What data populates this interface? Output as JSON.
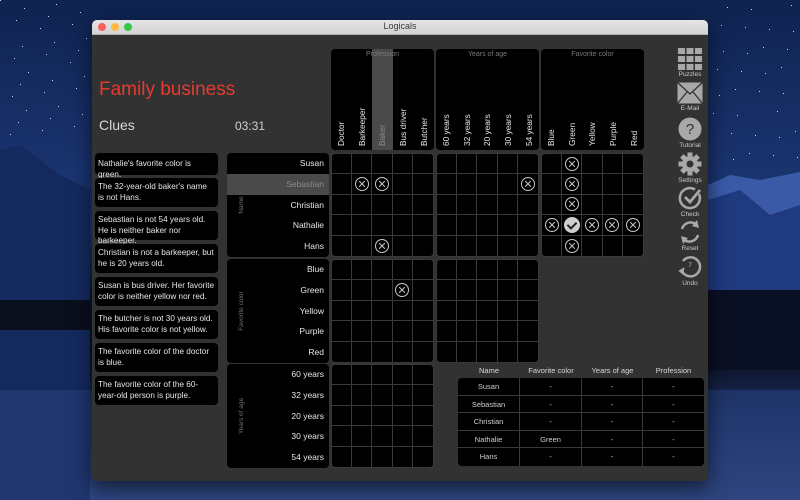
{
  "window": {
    "title": "Logicals"
  },
  "puzzle": {
    "title": "Family business",
    "clues_label": "Clues",
    "timer": "03:31"
  },
  "clues": [
    "Nathalie's favorite color is green.",
    "The 32-year-old baker's name is not Hans.",
    "Sebastian is not 54 years old. He is neither baker nor barkeeper.",
    "Christian is not a barkeeper, but he is 20 years old.",
    "Susan is bus driver. Her favorite color is neither yellow nor red.",
    "The butcher is not 30 years old. His favorite color is not yellow.",
    "The favorite color of the doctor is blue.",
    "The favorite color of the 60-year-old person is purple."
  ],
  "columns": [
    {
      "title": "Profession",
      "items": [
        "Doctor",
        "Barkeeper",
        "Baker",
        "Bus driver",
        "Butcher"
      ],
      "highlight": 2
    },
    {
      "title": "Years of age",
      "items": [
        "60 years",
        "32 years",
        "20 years",
        "30 years",
        "54 years"
      ],
      "highlight": -1
    },
    {
      "title": "Favorite color",
      "items": [
        "Blue",
        "Green",
        "Yellow",
        "Purple",
        "Red"
      ],
      "highlight": -1
    }
  ],
  "rows": [
    {
      "title": "Name",
      "items": [
        "Susan",
        "Sebastian",
        "Christian",
        "Nathalie",
        "Hans"
      ],
      "highlight": 1
    },
    {
      "title": "Favorite color",
      "items": [
        "Blue",
        "Green",
        "Yellow",
        "Purple",
        "Red"
      ],
      "highlight": -1
    },
    {
      "title": "Years of age",
      "items": [
        "60 years",
        "32 years",
        "20 years",
        "30 years",
        "54 years"
      ],
      "highlight": -1
    }
  ],
  "grids": [
    {
      "row": 0,
      "col": 0,
      "marks": [
        [
          "",
          "",
          "",
          "",
          ""
        ],
        [
          "",
          "x",
          "x",
          "",
          ""
        ],
        [
          "",
          "",
          "",
          "",
          ""
        ],
        [
          "",
          "",
          "",
          "",
          ""
        ],
        [
          "",
          "",
          "x",
          "",
          ""
        ]
      ]
    },
    {
      "row": 0,
      "col": 1,
      "marks": [
        [
          "",
          "",
          "",
          "",
          ""
        ],
        [
          "",
          "",
          "",
          "",
          "x"
        ],
        [
          "",
          "",
          "",
          "",
          ""
        ],
        [
          "",
          "",
          "",
          "",
          ""
        ],
        [
          "",
          "",
          "",
          "",
          ""
        ]
      ]
    },
    {
      "row": 0,
      "col": 2,
      "marks": [
        [
          "",
          "x",
          "",
          "",
          ""
        ],
        [
          "",
          "x",
          "",
          "",
          ""
        ],
        [
          "",
          "x",
          "",
          "",
          ""
        ],
        [
          "x",
          "check",
          "x",
          "x",
          "x"
        ],
        [
          "",
          "x",
          "",
          "",
          ""
        ]
      ]
    },
    {
      "row": 1,
      "col": 0,
      "marks": [
        [
          "",
          "",
          "",
          "",
          ""
        ],
        [
          "",
          "",
          "",
          "x",
          ""
        ],
        [
          "",
          "",
          "",
          "",
          ""
        ],
        [
          "",
          "",
          "",
          "",
          ""
        ],
        [
          "",
          "",
          "",
          "",
          ""
        ]
      ]
    },
    {
      "row": 1,
      "col": 1,
      "marks": [
        [
          "",
          "",
          "",
          "",
          ""
        ],
        [
          "",
          "",
          "",
          "",
          ""
        ],
        [
          "",
          "",
          "",
          "",
          ""
        ],
        [
          "",
          "",
          "",
          "",
          ""
        ],
        [
          "",
          "",
          "",
          "",
          ""
        ]
      ]
    },
    {
      "row": 2,
      "col": 0,
      "marks": [
        [
          "",
          "",
          "",
          "",
          ""
        ],
        [
          "",
          "",
          "",
          "",
          ""
        ],
        [
          "",
          "",
          "",
          "",
          ""
        ],
        [
          "",
          "",
          "",
          "",
          ""
        ],
        [
          "",
          "",
          "",
          "",
          ""
        ]
      ]
    }
  ],
  "summary": {
    "headers": [
      "Name",
      "Favorite color",
      "Years of age",
      "Profession"
    ],
    "rows": [
      [
        "Susan",
        "-",
        "-",
        "-"
      ],
      [
        "Sebastian",
        "-",
        "-",
        "-"
      ],
      [
        "Christian",
        "-",
        "-",
        "-"
      ],
      [
        "Nathalie",
        "Green",
        "-",
        "-"
      ],
      [
        "Hans",
        "-",
        "-",
        "-"
      ]
    ]
  },
  "toolbar": [
    {
      "label": "Puzzles",
      "icon": "grid-icon"
    },
    {
      "label": "E-Mail",
      "icon": "envelope-icon"
    },
    {
      "label": "Tutorial",
      "icon": "question-icon"
    },
    {
      "label": "Settings",
      "icon": "gear-icon"
    },
    {
      "label": "Check",
      "icon": "check-circle-icon"
    },
    {
      "label": "Reset",
      "icon": "reset-icon"
    },
    {
      "label": "Undo",
      "icon": "undo-icon",
      "badge": "7"
    }
  ]
}
